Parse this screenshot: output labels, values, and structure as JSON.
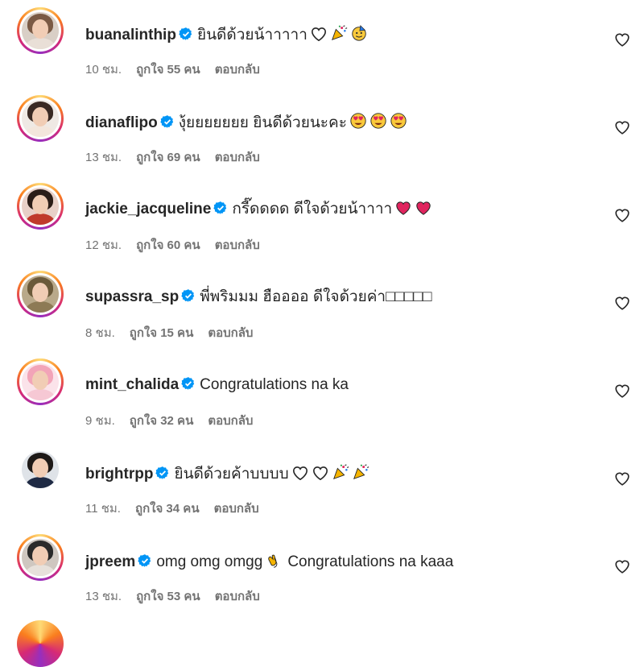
{
  "comments": [
    {
      "username": "buanalinthip",
      "text": "ยินดีด้วยน้าาาาา",
      "emojis": [
        "white-heart",
        "party-popper",
        "party-face"
      ],
      "time": "10 ชม.",
      "likes": "ถูกใจ 55 คน",
      "reply": "ตอบกลับ",
      "avatar": {
        "hair": "#7a5a45",
        "body": "#e9dfd7",
        "bg": "#d9cfc6"
      },
      "story_ring": true
    },
    {
      "username": "dianaflipo",
      "text": "งุ้ยยยยยยย ยินดีด้วยนะคะ",
      "emojis": [
        "heart-eyes",
        "heart-eyes",
        "heart-eyes"
      ],
      "time": "13 ชม.",
      "likes": "ถูกใจ 69 คน",
      "reply": "ตอบกลับ",
      "avatar": {
        "hair": "#3a2a24",
        "body": "#f3e6dc",
        "bg": "#efe9e4"
      },
      "story_ring": true
    },
    {
      "username": "jackie_jacqueline",
      "text": "กรี๊ดดดด ดีใจด้วยน้าาาา",
      "emojis": [
        "red-heart",
        "red-heart"
      ],
      "time": "12 ชม.",
      "likes": "ถูกใจ 60 คน",
      "reply": "ตอบกลับ",
      "avatar": {
        "hair": "#2b1d18",
        "body": "#c0392b",
        "bg": "#e8d0c8"
      },
      "story_ring": true
    },
    {
      "username": "supassra_sp",
      "text": "พี่พริมมม ฮืออออ ดีใจด้วยค่า□□□□□",
      "emojis": [],
      "time": "8 ชม.",
      "likes": "ถูกใจ 15 คน",
      "reply": "ตอบกลับ",
      "avatar": {
        "hair": "#6b5a3a",
        "body": "#8d7a55",
        "bg": "#b9a98a"
      },
      "story_ring": true
    },
    {
      "username": "mint_chalida",
      "text": "Congratulations na ka",
      "emojis": [],
      "time": "9 ชม.",
      "likes": "ถูกใจ 32 คน",
      "reply": "ตอบกลับ",
      "avatar": {
        "hair": "#f2a4b8",
        "body": "#f6c8d4",
        "bg": "#fbe3ea"
      },
      "story_ring": true
    },
    {
      "username": "brightrpp",
      "text": "ยินดีด้วยค้าบบบบ",
      "emojis": [
        "white-heart",
        "white-heart",
        "party-popper",
        "party-popper"
      ],
      "time": "11 ชม.",
      "likes": "ถูกใจ 34 คน",
      "reply": "ตอบกลับ",
      "avatar": {
        "hair": "#1e1a18",
        "body": "#1f2a44",
        "bg": "#dfe3e8"
      },
      "story_ring": false
    },
    {
      "username": "jpreem",
      "text": "omg omg omgg",
      "text2": "Congratulations na kaaa",
      "emojis": [
        "clapping-hands"
      ],
      "time": "13 ชม.",
      "likes": "ถูกใจ 53 คน",
      "reply": "ตอบกลับ",
      "avatar": {
        "hair": "#2a2a2a",
        "body": "#e7e1db",
        "bg": "#cfc7c0"
      },
      "story_ring": true
    }
  ],
  "colors": {
    "verified": "#0095f6",
    "meta_text": "#737373",
    "text": "#262626"
  },
  "icons": {
    "verified": "verified-badge-icon",
    "like": "heart-outline-icon"
  }
}
